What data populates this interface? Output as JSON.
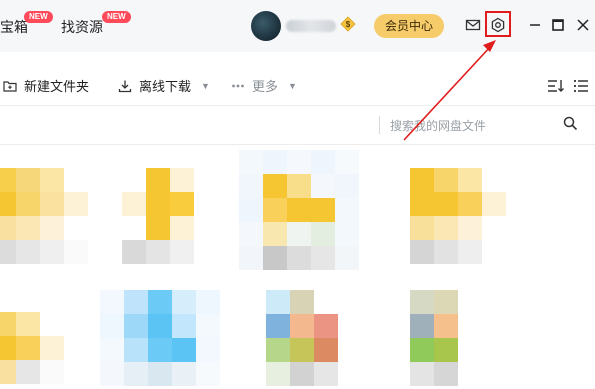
{
  "nav": {
    "items": [
      {
        "label": "宝箱",
        "badge": "NEW"
      },
      {
        "label": "找资源",
        "badge": "NEW"
      }
    ]
  },
  "header": {
    "vip_button": "会员中心",
    "icons": [
      "mail-icon",
      "settings-icon",
      "minimize-icon",
      "maximize-icon",
      "close-icon"
    ]
  },
  "toolbar": {
    "new_folder": "新建文件夹",
    "offline_download": "离线下载",
    "more": "更多"
  },
  "search": {
    "placeholder": "搜索我的网盘文件"
  },
  "colors": {
    "accent_vip": "#f6cc6b",
    "badge": "#ff4a5a",
    "highlight_red": "#e01c1c"
  }
}
